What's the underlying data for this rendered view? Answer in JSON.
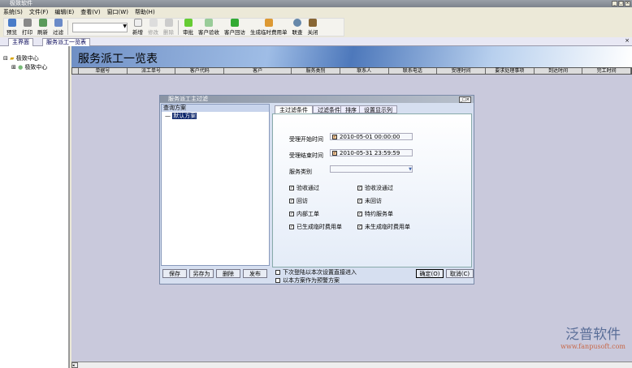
{
  "window": {
    "title": "极致软件"
  },
  "menu": [
    "系统(S)",
    "文件(F)",
    "编辑(E)",
    "查看(V)",
    "窗口(W)",
    "帮助(H)"
  ],
  "toolbar": [
    "预览",
    "打印",
    "刷新",
    "过滤",
    "新增",
    "修改",
    "删除",
    "审批",
    "客户验收",
    "客户回访",
    "生成临时费用单",
    "联查",
    "关闭"
  ],
  "tabs": [
    "主界面",
    "服务派工一览表"
  ],
  "tree": {
    "root": "极致中心",
    "child": "极致中心"
  },
  "page": {
    "title": "服务派工一览表",
    "columns": [
      "单据号",
      "派工单号",
      "客户代码",
      "客户",
      "服务类别",
      "联系人",
      "联系电话",
      "受理时间",
      "要求处理事项",
      "到达时间",
      "完工时间"
    ]
  },
  "dialog": {
    "title": "服务派工主过滤",
    "scheme_header": "查询方案",
    "scheme_item": "默认方案",
    "tabs": [
      "主过滤条件",
      "过滤条件",
      "排序",
      "设置显示列"
    ],
    "start_label": "受理开始时间",
    "start_value": "2010-05-01 00:00:00",
    "end_label": "受理结束时间",
    "end_value": "2010-05-31 23:59:59",
    "category_label": "服务类别",
    "checks": [
      "验收通过",
      "验收没通过",
      "回访",
      "未回访",
      "内部工单",
      "特约服务单",
      "已生成临时费用单",
      "未生成临时费用单"
    ],
    "left_buttons": [
      "保存",
      "另存为",
      "删除",
      "发布"
    ],
    "opt1": "下次登陆以本次设置直接进入",
    "opt2": "以本方案作为预警方案",
    "ok": "确定(O)",
    "cancel": "取消(C)"
  },
  "watermark": {
    "brand": "泛普软件",
    "url": "www.fanpusoft.com"
  }
}
